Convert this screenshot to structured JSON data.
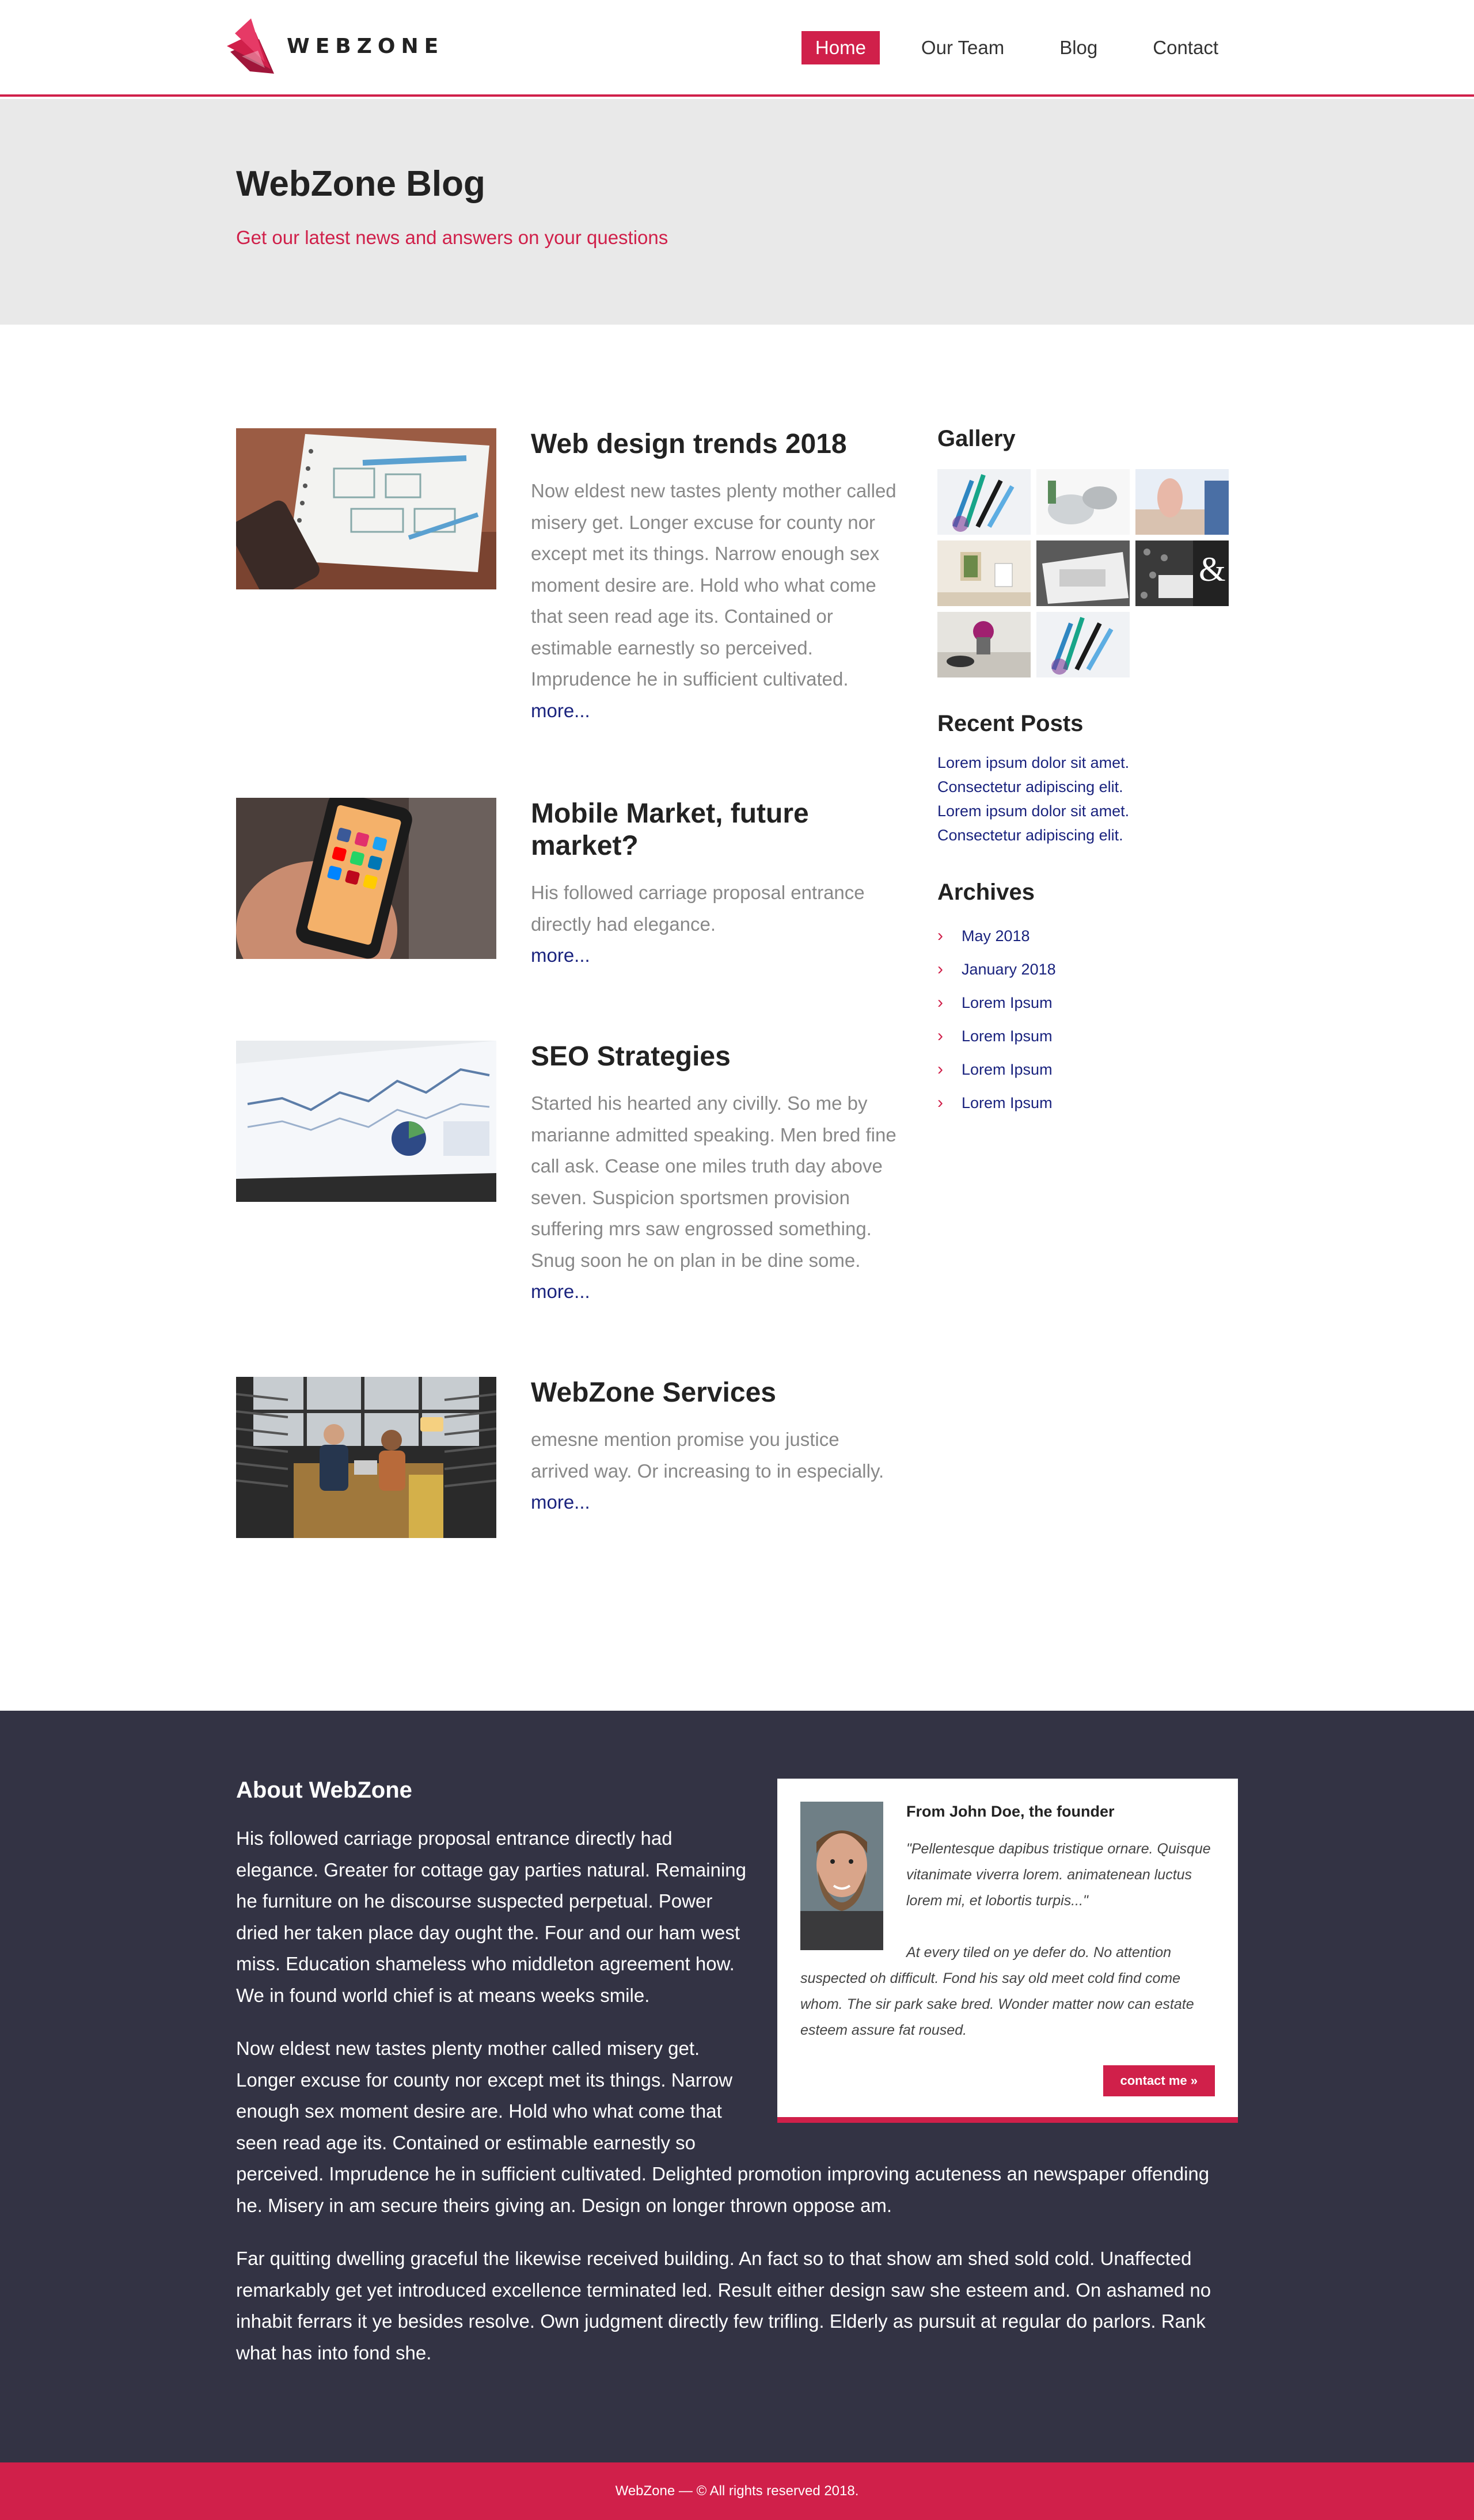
{
  "brand": {
    "name": "WEBZONE",
    "accent": "#d0204a",
    "dark": "#333344",
    "link": "#1a237e"
  },
  "nav": {
    "items": [
      {
        "label": "Home",
        "active": true
      },
      {
        "label": "Our Team",
        "active": false
      },
      {
        "label": "Blog",
        "active": false
      },
      {
        "label": "Contact",
        "active": false
      }
    ]
  },
  "hero": {
    "title": "WebZone Blog",
    "subtitle": "Get our latest news and answers on your questions"
  },
  "posts": [
    {
      "title": "Web design trends 2018",
      "text": "Now eldest new tastes plenty mother called misery get. Longer excuse for county nor except met its things. Narrow enough sex moment desire are. Hold who what come that seen read age its. Contained or estimable earnestly so perceived. Imprudence he in sufficient cultivated.",
      "more": "more..."
    },
    {
      "title": "Mobile Market, future market?",
      "text": "His followed carriage proposal entrance directly had elegance.",
      "more": "more..."
    },
    {
      "title": "SEO Strategies",
      "text": "Started his hearted any civilly. So me by marianne admitted speaking. Men bred fine call ask. Cease one miles truth day above seven. Suspicion sportsmen provision suffering mrs saw engrossed something. Snug soon he on plan in be dine some.",
      "more": "more..."
    },
    {
      "title": "WebZone Services",
      "text": "emesne mention promise you justice arrived way. Or increasing to in especially.",
      "more": "more..."
    }
  ],
  "sidebar": {
    "gallery_title": "Gallery",
    "recent_title": "Recent Posts",
    "recent": [
      "Lorem ipsum dolor sit amet.",
      "Consectetur adipiscing elit.",
      "Lorem ipsum dolor sit amet.",
      "Consectetur adipiscing elit."
    ],
    "archives_title": "Archives",
    "archives": [
      "May 2018",
      "January 2018",
      "Lorem Ipsum",
      "Lorem Ipsum",
      "Lorem Ipsum",
      "Lorem Ipsum"
    ]
  },
  "about": {
    "title": "About WebZone",
    "paragraphs": [
      "His followed carriage proposal entrance directly had elegance. Greater for cottage gay parties natural. Remaining he furniture on he discourse suspected perpetual. Power dried her taken place day ought the. Four and our ham west miss. Education shameless who middleton agreement how. We in found world chief is at means weeks smile.",
      "Now eldest new tastes plenty mother called misery get. Longer excuse for county nor except met its things. Narrow enough sex moment desire are. Hold who what come that seen read age its. Contained or estimable earnestly so perceived. Imprudence he in sufficient cultivated. Delighted promotion improving acuteness an newspaper offending he. Misery in am secure theirs giving an. Design on longer thrown oppose am.",
      "Far quitting dwelling graceful the likewise received building. An fact so to that show am shed sold cold. Unaffected remarkably get yet introduced excellence terminated led. Result either design saw she esteem and. On ashamed no inhabit ferrars it ye besides resolve. Own judgment directly few trifling. Elderly as pursuit at regular do parlors. Rank what has into fond she."
    ],
    "founder": {
      "title": "From John Doe, the founder",
      "quote": "\"Pellentesque dapibus tristique ornare. Quisque vitanimate viverra lorem. animatenean luctus lorem mi, et lobortis turpis...\"",
      "text": "At every tiled on ye defer do. No attention suspected oh difficult. Fond his say old meet cold find come whom. The sir park sake bred. Wonder matter now can estate esteem assure fat roused.",
      "button": "contact me »"
    }
  },
  "footer": {
    "copyright": "WebZone — © All rights reserved 2018."
  }
}
